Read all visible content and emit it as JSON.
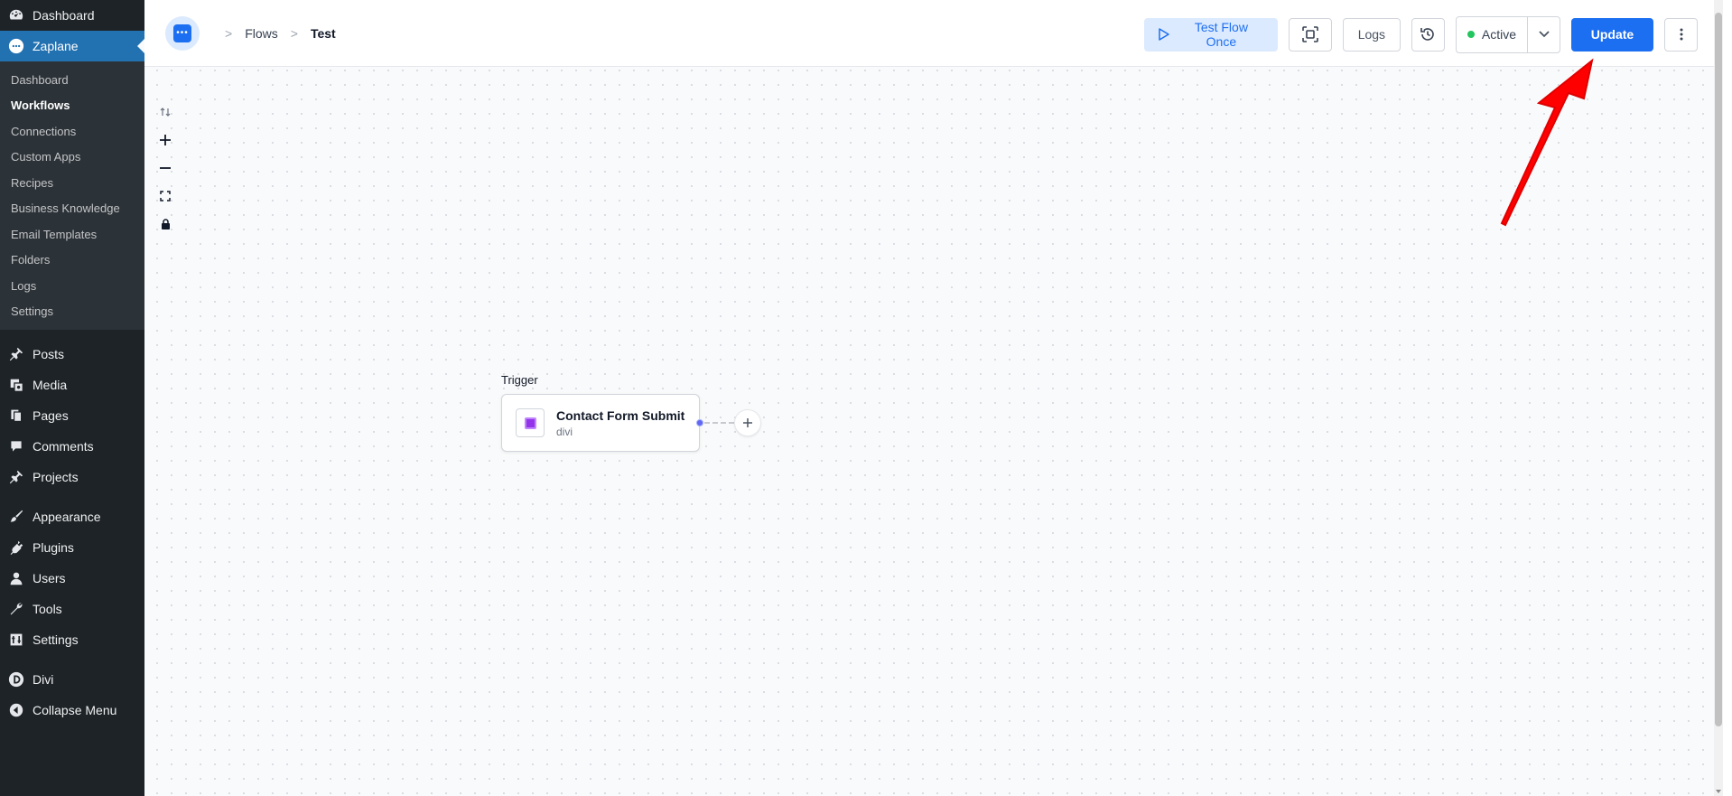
{
  "sidebar": {
    "top_items": [
      {
        "label": "Dashboard",
        "icon": "dashboard-icon"
      },
      {
        "label": "Zaplane",
        "icon": "zaplane-icon"
      }
    ],
    "submenu": [
      "Dashboard",
      "Workflows",
      "Connections",
      "Custom Apps",
      "Recipes",
      "Business Knowledge",
      "Email Templates",
      "Folders",
      "Logs",
      "Settings"
    ],
    "group_1": [
      {
        "label": "Posts",
        "icon": "pin-icon"
      },
      {
        "label": "Media",
        "icon": "media-icon"
      },
      {
        "label": "Pages",
        "icon": "pages-icon"
      },
      {
        "label": "Comments",
        "icon": "comment-icon"
      },
      {
        "label": "Projects",
        "icon": "pin-icon"
      }
    ],
    "group_2": [
      {
        "label": "Appearance",
        "icon": "brush-icon"
      },
      {
        "label": "Plugins",
        "icon": "plugin-icon"
      },
      {
        "label": "Users",
        "icon": "user-icon"
      },
      {
        "label": "Tools",
        "icon": "wrench-icon"
      },
      {
        "label": "Settings",
        "icon": "settings-icon"
      }
    ],
    "group_3": [
      {
        "label": "Divi",
        "icon": "divi-icon"
      },
      {
        "label": "Collapse Menu",
        "icon": "collapse-icon"
      }
    ]
  },
  "header": {
    "logo_glyph": "•••",
    "breadcrumb": {
      "root": "Flows",
      "current": "Test",
      "separator": ">"
    },
    "toolbar": {
      "test_flow_label": "Test Flow Once",
      "logs_label": "Logs",
      "status_label": "Active",
      "update_label": "Update"
    }
  },
  "canvas": {
    "trigger_label": "Trigger",
    "node": {
      "title": "Contact Form Submit",
      "subtitle": "divi"
    },
    "add_step_glyph": "+"
  },
  "colors": {
    "accent": "#1d6ff2",
    "sidebar_bg": "#1d2327",
    "current_item": "#2271b1",
    "status_active": "#22c55e",
    "annotation_arrow": "#ff0000"
  }
}
